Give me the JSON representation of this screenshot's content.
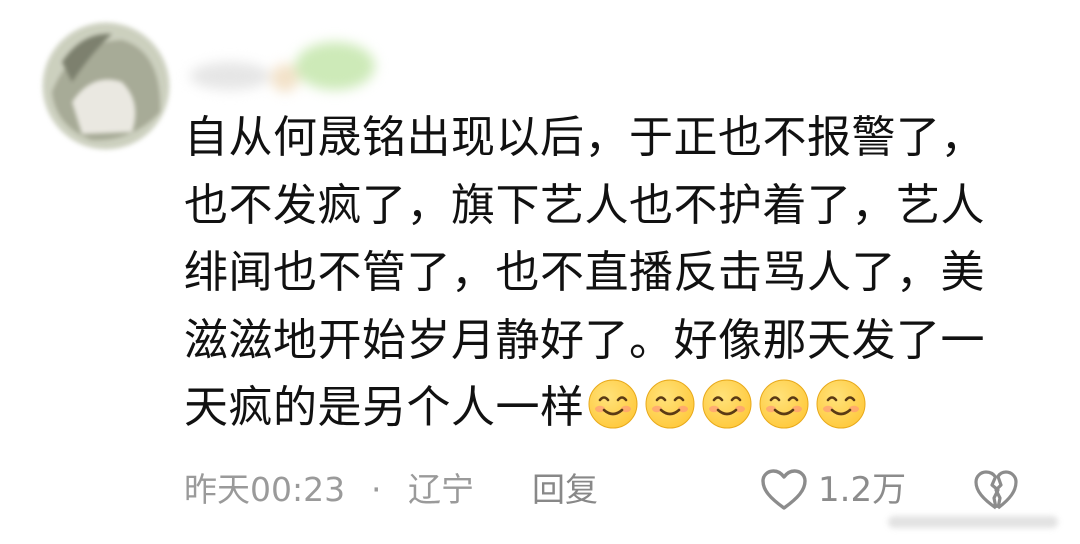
{
  "comment": {
    "text": "自从何晟铭出现以后，于正也不报警了，\n也不发疯了，旗下艺人也不护着了，艺人\n绯闻也不管了，也不直播反击骂人了，美\n滋滋地开始岁月静好了。好像那天发了一\n天疯的是另个人一样",
    "emoji_count": 5
  },
  "meta": {
    "time": "昨天00:23",
    "separator": "·",
    "location": "辽宁",
    "reply_label": "回复",
    "like_count": "1.2万"
  },
  "colors": {
    "text": "#111111",
    "meta": "#9a9a9a",
    "emoji_face": "#FFC93C",
    "emoji_blush": "#FF8A80"
  },
  "icons": {
    "avatar": "avatar-image",
    "like": "heart-outline-icon",
    "dislike": "broken-heart-icon",
    "emoji": "smiling-face-emoji"
  }
}
